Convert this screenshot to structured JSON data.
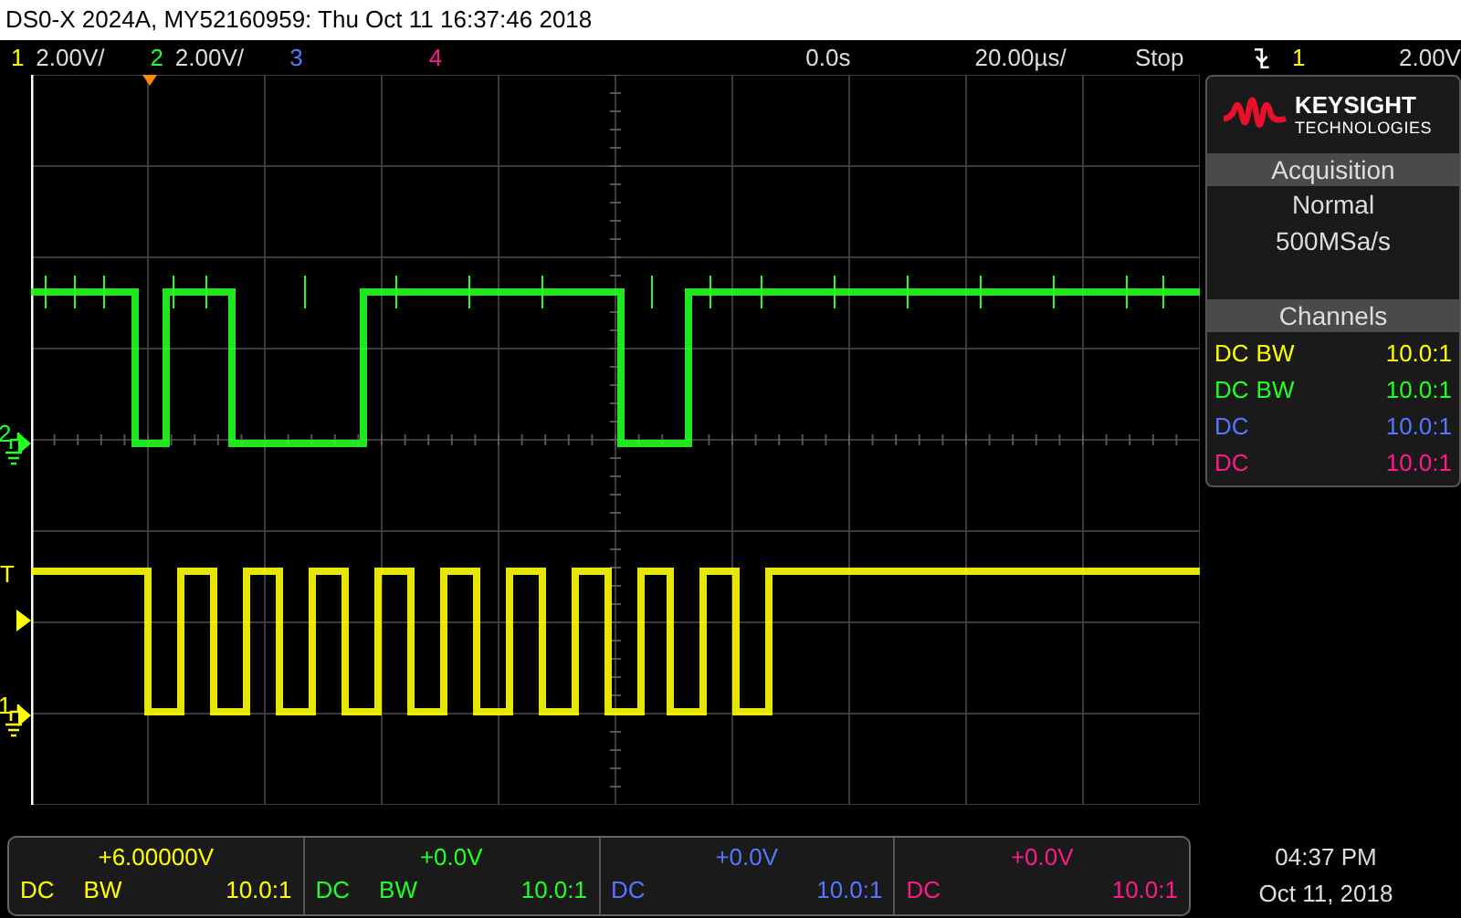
{
  "window": {
    "title": "DS0-X 2024A, MY52160959: Thu Oct 11 16:37:46 2018"
  },
  "header": {
    "channels": [
      {
        "number": "1",
        "scale": "2.00V/",
        "color": "#ffff00"
      },
      {
        "number": "2",
        "scale": "2.00V/",
        "color": "#22ff22"
      },
      {
        "number": "3",
        "color": "#5577ff"
      },
      {
        "number": "4",
        "color": "#ff1a8c"
      }
    ],
    "delay": "0.0s",
    "timebase": "20.00µs/",
    "run_state": "Stop",
    "trigger_channel": "1",
    "trigger_level": "2.00V"
  },
  "graticule_markers": [
    {
      "label": "2",
      "kind": "ground",
      "color": "#22ff22"
    },
    {
      "label": "T",
      "kind": "trigger",
      "color": "#ffff00"
    },
    {
      "label": "1",
      "kind": "ground",
      "color": "#ffff00"
    }
  ],
  "panel": {
    "brand": "KEYSIGHT",
    "brand_sub": "TECHNOLOGIES",
    "acquisition": {
      "title": "Acquisition",
      "mode": "Normal",
      "rate": "500MSa/s"
    },
    "channels_title": "Channels",
    "channels": [
      {
        "coupling": "DC",
        "bw": "BW",
        "probe": "10.0:1",
        "color": "#ffff00"
      },
      {
        "coupling": "DC",
        "bw": "BW",
        "probe": "10.0:1",
        "color": "#22ff22"
      },
      {
        "coupling": "DC",
        "probe": "10.0:1",
        "color": "#5577ff"
      },
      {
        "coupling": "DC",
        "probe": "10.0:1",
        "color": "#ff1a8c"
      }
    ]
  },
  "footer": {
    "channels": [
      {
        "offset": "+6.00000V",
        "coupling": "DC",
        "bw": "BW",
        "probe": "10.0:1",
        "color": "#ffff00"
      },
      {
        "offset": "+0.0V",
        "coupling": "DC",
        "bw": "BW",
        "probe": "10.0:1",
        "color": "#22ff22"
      },
      {
        "offset": "+0.0V",
        "coupling": "DC",
        "probe": "10.0:1",
        "color": "#5577ff"
      },
      {
        "offset": "+0.0V",
        "coupling": "DC",
        "probe": "10.0:1",
        "color": "#ff1a8c"
      }
    ],
    "time": "04:37 PM",
    "date": "Oct 11, 2018"
  }
}
